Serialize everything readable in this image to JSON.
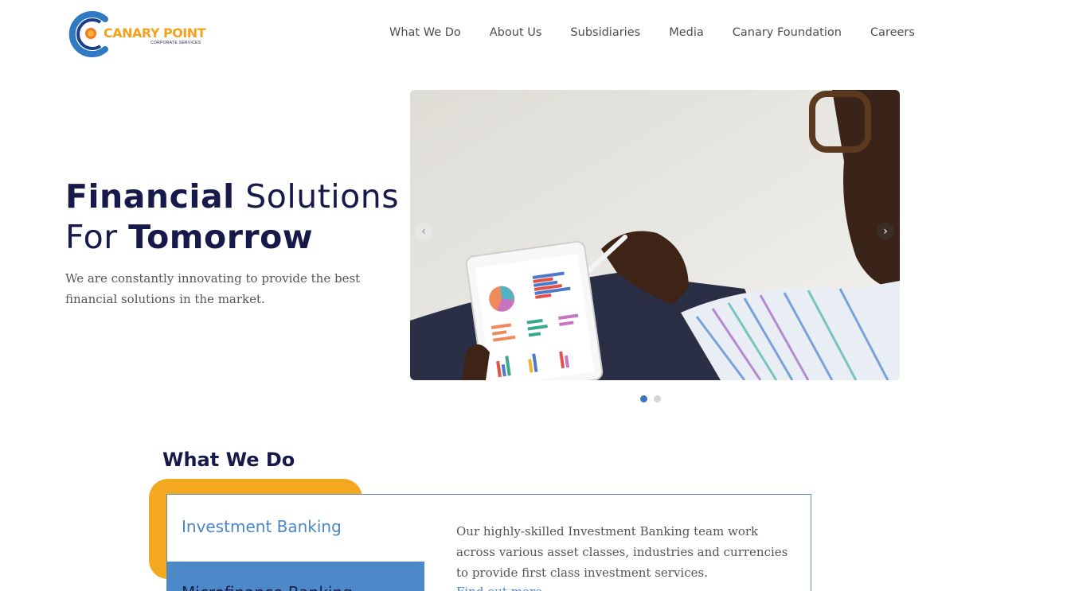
{
  "logo": {
    "name": "CANARY POINT",
    "tagline": "CORPORATE SERVICES"
  },
  "nav": {
    "items": [
      "What We Do",
      "About Us",
      "Subsidiaries",
      "Media",
      "Canary Foundation",
      "Careers"
    ]
  },
  "hero": {
    "title_bold_1": "Financial",
    "title_regular_1": " Solutions",
    "title_regular_2": "For ",
    "title_bold_2": "Tomorrow",
    "subtitle": "We are constantly innovating to provide the best financial solutions in the market."
  },
  "carousel": {
    "prev": "‹",
    "next": "›",
    "slide_count": 2,
    "active_slide": 1
  },
  "what_we_do": {
    "title_bold_1": "What",
    "title_regular": " We ",
    "title_bold_2": "Do",
    "tabs": [
      "Investment Banking",
      "Microfinance Banking"
    ],
    "description": "Our highly-skilled Investment Banking team work across various asset classes, industries and currencies to provide first class investment services.",
    "link": "Find out more"
  },
  "colors": {
    "brand_orange": "#f3a81f",
    "brand_blue": "#4d89c9",
    "navy": "#16194a"
  }
}
